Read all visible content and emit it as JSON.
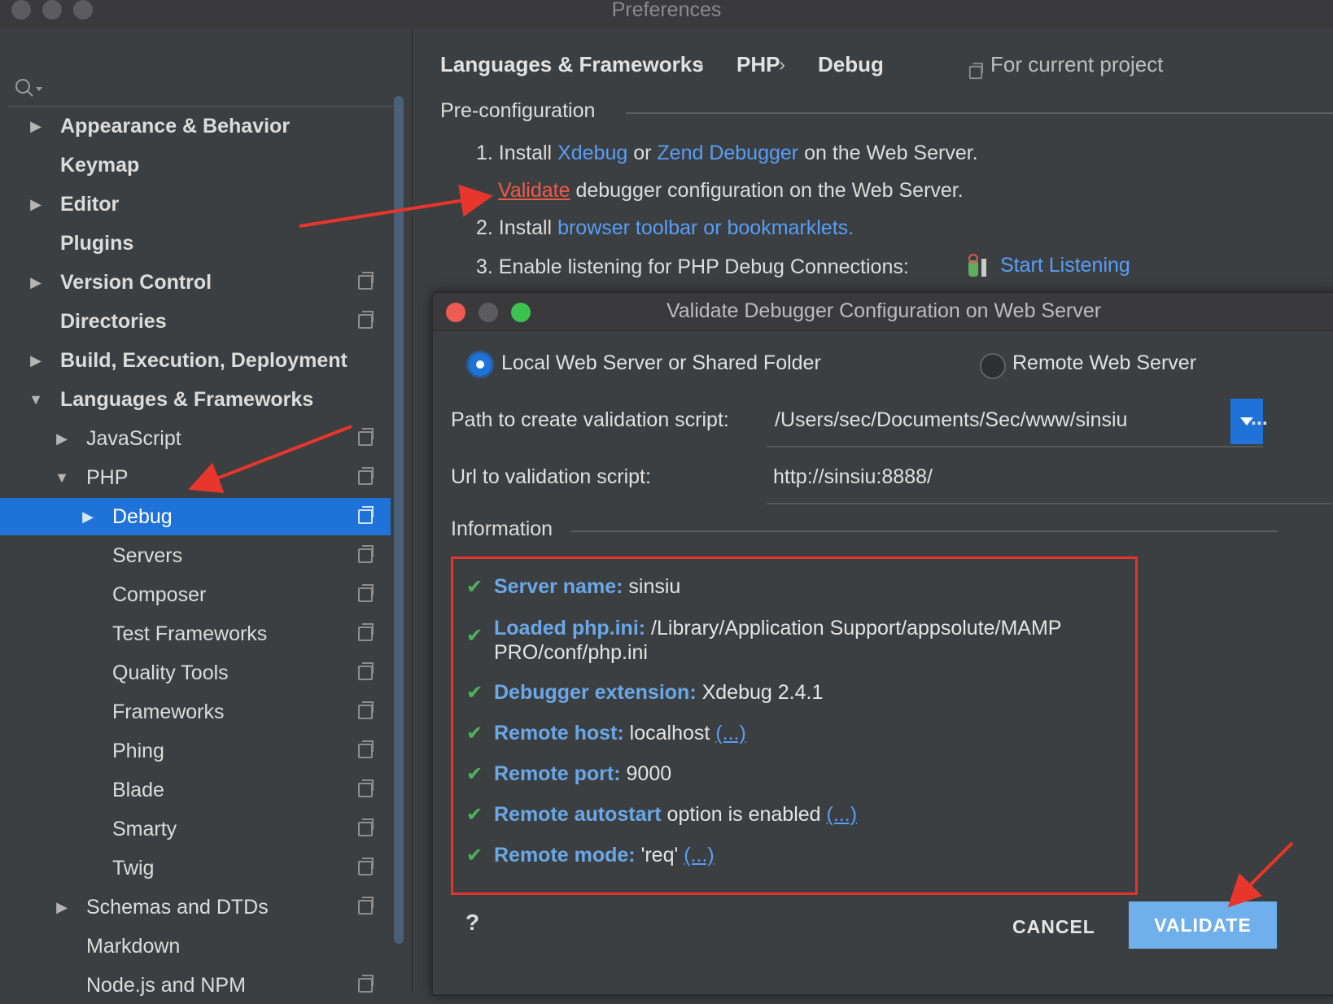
{
  "window": {
    "title": "Preferences"
  },
  "sidebar": {
    "items": [
      {
        "label": "Appearance & Behavior",
        "arrow": "▶",
        "level": 0,
        "bold": true,
        "copy": false
      },
      {
        "label": "Keymap",
        "arrow": "",
        "level": 0,
        "bold": true,
        "copy": false
      },
      {
        "label": "Editor",
        "arrow": "▶",
        "level": 0,
        "bold": true,
        "copy": false
      },
      {
        "label": "Plugins",
        "arrow": "",
        "level": 0,
        "bold": true,
        "copy": false
      },
      {
        "label": "Version Control",
        "arrow": "▶",
        "level": 0,
        "bold": true,
        "copy": true
      },
      {
        "label": "Directories",
        "arrow": "",
        "level": 0,
        "bold": true,
        "copy": true
      },
      {
        "label": "Build, Execution, Deployment",
        "arrow": "▶",
        "level": 0,
        "bold": true,
        "copy": false
      },
      {
        "label": "Languages & Frameworks",
        "arrow": "▼",
        "level": 0,
        "bold": true,
        "copy": false
      },
      {
        "label": "JavaScript",
        "arrow": "▶",
        "level": 1,
        "bold": false,
        "copy": true
      },
      {
        "label": "PHP",
        "arrow": "▼",
        "level": 1,
        "bold": false,
        "copy": true
      },
      {
        "label": "Debug",
        "arrow": "▶",
        "level": 2,
        "bold": false,
        "copy": true,
        "selected": true
      },
      {
        "label": "Servers",
        "arrow": "",
        "level": 2,
        "bold": false,
        "copy": true
      },
      {
        "label": "Composer",
        "arrow": "",
        "level": 2,
        "bold": false,
        "copy": true
      },
      {
        "label": "Test Frameworks",
        "arrow": "",
        "level": 2,
        "bold": false,
        "copy": true
      },
      {
        "label": "Quality Tools",
        "arrow": "",
        "level": 2,
        "bold": false,
        "copy": true
      },
      {
        "label": "Frameworks",
        "arrow": "",
        "level": 2,
        "bold": false,
        "copy": true
      },
      {
        "label": "Phing",
        "arrow": "",
        "level": 2,
        "bold": false,
        "copy": true
      },
      {
        "label": "Blade",
        "arrow": "",
        "level": 2,
        "bold": false,
        "copy": true
      },
      {
        "label": "Smarty",
        "arrow": "",
        "level": 2,
        "bold": false,
        "copy": true
      },
      {
        "label": "Twig",
        "arrow": "",
        "level": 2,
        "bold": false,
        "copy": true
      },
      {
        "label": "Schemas and DTDs",
        "arrow": "▶",
        "level": 1,
        "bold": false,
        "copy": true
      },
      {
        "label": "Markdown",
        "arrow": "",
        "level": 1,
        "bold": false,
        "copy": false
      },
      {
        "label": "Node.js and NPM",
        "arrow": "",
        "level": 1,
        "bold": false,
        "copy": true
      }
    ]
  },
  "breadcrumb": {
    "c1": "Languages & Frameworks",
    "c2": "PHP",
    "c3": "Debug",
    "sep": "›",
    "project": "For current project"
  },
  "preconfig": {
    "title": "Pre-configuration",
    "step1_a": "1. Install ",
    "xdebug": "Xdebug",
    "or": " or ",
    "zend": "Zend Debugger",
    "step1_b": " on the Web Server.",
    "validate_link": "Validate",
    "validate_rest": " debugger configuration on the Web Server.",
    "step2_a": "2. Install ",
    "toolbar_link": "browser toolbar or bookmarklets.",
    "step3_a": "3. Enable listening for PHP Debug Connections:",
    "start_listening": "Start Listening"
  },
  "dialog": {
    "title": "Validate Debugger Configuration on Web Server",
    "radio_local": "Local Web Server or Shared Folder",
    "radio_remote": "Remote Web Server",
    "path_label": "Path to create validation script:",
    "path_value": "/Users/sec/Documents/Sec/www/sinsiu",
    "browse": "...",
    "url_label": "Url to validation script:",
    "url_value": "http://sinsiu:8888/",
    "info_title": "Information",
    "info": {
      "server_key": "Server name:",
      "server_val": " sinsiu",
      "ini_key": "Loaded php.ini:",
      "ini_val1": " /Library/Application Support/appsolute/MAMP",
      "ini_val2": "PRO/conf/php.ini",
      "ext_key": "Debugger extension:",
      "ext_val": " Xdebug 2.4.1",
      "host_key": "Remote host:",
      "host_val": " localhost ",
      "host_more": "(...)",
      "port_key": "Remote port:",
      "port_val": " 9000",
      "auto_key": "Remote autostart",
      "auto_val": " option is enabled ",
      "auto_more": "(...)",
      "mode_key": "Remote mode:",
      "mode_val": " 'req' ",
      "mode_more": "(...)"
    },
    "help": "?",
    "cancel": "CANCEL",
    "validate": "VALIDATE"
  }
}
